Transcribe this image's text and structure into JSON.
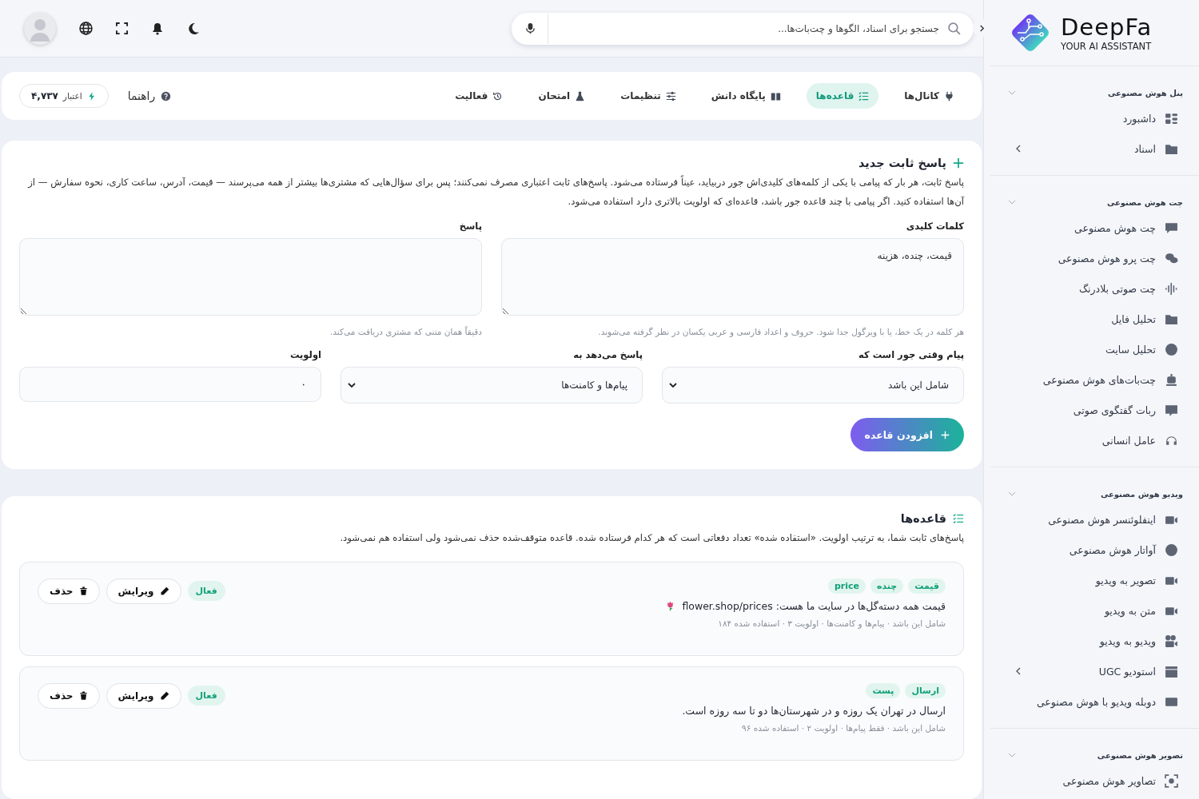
{
  "sidebar": {
    "brand": "DeepFa",
    "tagline": "YOUR AI ASSISTANT",
    "groups": [
      {
        "title": "پنل هوش مصنوعی",
        "expanded": true,
        "items": [
          {
            "label": "داشبورد",
            "has_submenu": false
          },
          {
            "label": "اسناد",
            "has_submenu": true
          }
        ]
      },
      {
        "title": "چت هوش مصنوعی",
        "expanded": true,
        "items": [
          {
            "label": "چت هوش مصنوعی",
            "has_submenu": false
          },
          {
            "label": "چت پرو هوش مصنوعی",
            "has_submenu": false
          },
          {
            "label": "چت صوتی بلادرنگ",
            "has_submenu": false
          },
          {
            "label": "تحلیل فایل",
            "has_submenu": false
          },
          {
            "label": "تحلیل سایت",
            "has_submenu": false
          },
          {
            "label": "چت‌بات‌های هوش مصنوعی",
            "has_submenu": false
          },
          {
            "label": "ربات گفتگوی صوتی",
            "has_submenu": false
          },
          {
            "label": "عامل انسانی",
            "has_submenu": false
          }
        ]
      },
      {
        "title": "ویدیو هوش مصنوعی",
        "expanded": true,
        "items": [
          {
            "label": "اینفلوئنسر هوش مصنوعی",
            "has_submenu": false
          },
          {
            "label": "آواتار هوش مصنوعی",
            "has_submenu": false
          },
          {
            "label": "تصویر به ویدیو",
            "has_submenu": false
          },
          {
            "label": "متن به ویدیو",
            "has_submenu": false
          },
          {
            "label": "ویدیو به ویدیو",
            "has_submenu": false
          },
          {
            "label": "استودیو UGC",
            "has_submenu": true
          },
          {
            "label": "دوبله ویدیو با هوش مصنوعی",
            "has_submenu": false
          }
        ]
      },
      {
        "title": "تصویر هوش مصنوعی",
        "expanded": true,
        "items": [
          {
            "label": "تصاویر هوش مصنوعی",
            "has_submenu": false
          }
        ]
      }
    ]
  },
  "header": {
    "search": {
      "placeholder": "جستجو برای اسناد، الگوها و چت‌بات‌ها..."
    }
  },
  "tabs": [
    {
      "label": "کانال‌ها",
      "selected": false
    },
    {
      "label": "قاعده‌ها",
      "selected": true
    },
    {
      "label": "پایگاه دانش",
      "selected": false
    },
    {
      "label": "تنظیمات",
      "selected": false
    },
    {
      "label": "امتحان",
      "selected": false
    },
    {
      "label": "فعالیت",
      "selected": false
    }
  ],
  "help": "راهنما",
  "credit": {
    "label": "اعتبار",
    "value": "۴,۷۳۷"
  },
  "form": {
    "title": "پاسخ ثابت جدید",
    "description": "پاسخ ثابت، هر بار که پیامی با یکی از کلمه‌های کلیدی‌اش جور دربیاید، عیناً فرستاده می‌شود. پاسخ‌های ثابت اعتباری مصرف نمی‌کنند؛ پس برای سؤال‌هایی که مشتری‌ها بیشتر از همه می‌پرسند — قیمت، آدرس، ساعت کاری، نحوه سفارش — از آن‌ها استفاده کنید. اگر پیامی با چند قاعده جور باشد، قاعده‌ای که اولویت بالاتری دارد استفاده می‌شود.",
    "keywords": {
      "label": "کلمات کلیدی",
      "value": "قیمت، چنده، هزینه",
      "hint": "هر کلمه در یک خط، یا با ویرگول جدا شود. حروف و اعداد فارسی و عربی یکسان در نظر گرفته می‌شوند."
    },
    "answer": {
      "label": "پاسخ",
      "hint": "دقیقاً همان متنی که مشتری دریافت می‌کند."
    },
    "match": {
      "label": "پیام وقتی جور است که",
      "value": "شامل این باشد"
    },
    "reply_to": {
      "label": "پاسخ می‌دهد به",
      "value": "پیام‌ها و کامنت‌ها"
    },
    "priority": {
      "label": "اولویت",
      "value": "۰"
    },
    "submit": "افزودن قاعده"
  },
  "rules": {
    "title": "قاعده‌ها",
    "description": "پاسخ‌های ثابت شما، به ترتیب اولویت. «استفاده شده» تعداد دفعاتی است که هر کدام فرستاده شده. قاعده متوقف‌شده حذف نمی‌شود ولی استفاده هم نمی‌شود.",
    "items": [
      {
        "tags": [
          "قیمت",
          "چنده",
          "price"
        ],
        "text": "قیمت همه دسته‌گل‌ها در سایت ما هست: flower.shop/prices",
        "meta": "شامل این باشد · پیام‌ها و کامنت‌ها · اولویت ۳ · استفاده شده ۱۸۴",
        "status": "فعال",
        "active": true,
        "edit": "ویرایش",
        "delete": "حذف"
      },
      {
        "tags": [
          "ارسال",
          "پست"
        ],
        "text": "ارسال در تهران یک روزه و در شهرستان‌ها دو تا سه روزه است.",
        "meta": "شامل این باشد · فقط پیام‌ها · اولویت ۲ · استفاده شده ۹۶",
        "status": "فعال",
        "active": true,
        "edit": "ویرایش",
        "delete": "حذف"
      }
    ]
  }
}
